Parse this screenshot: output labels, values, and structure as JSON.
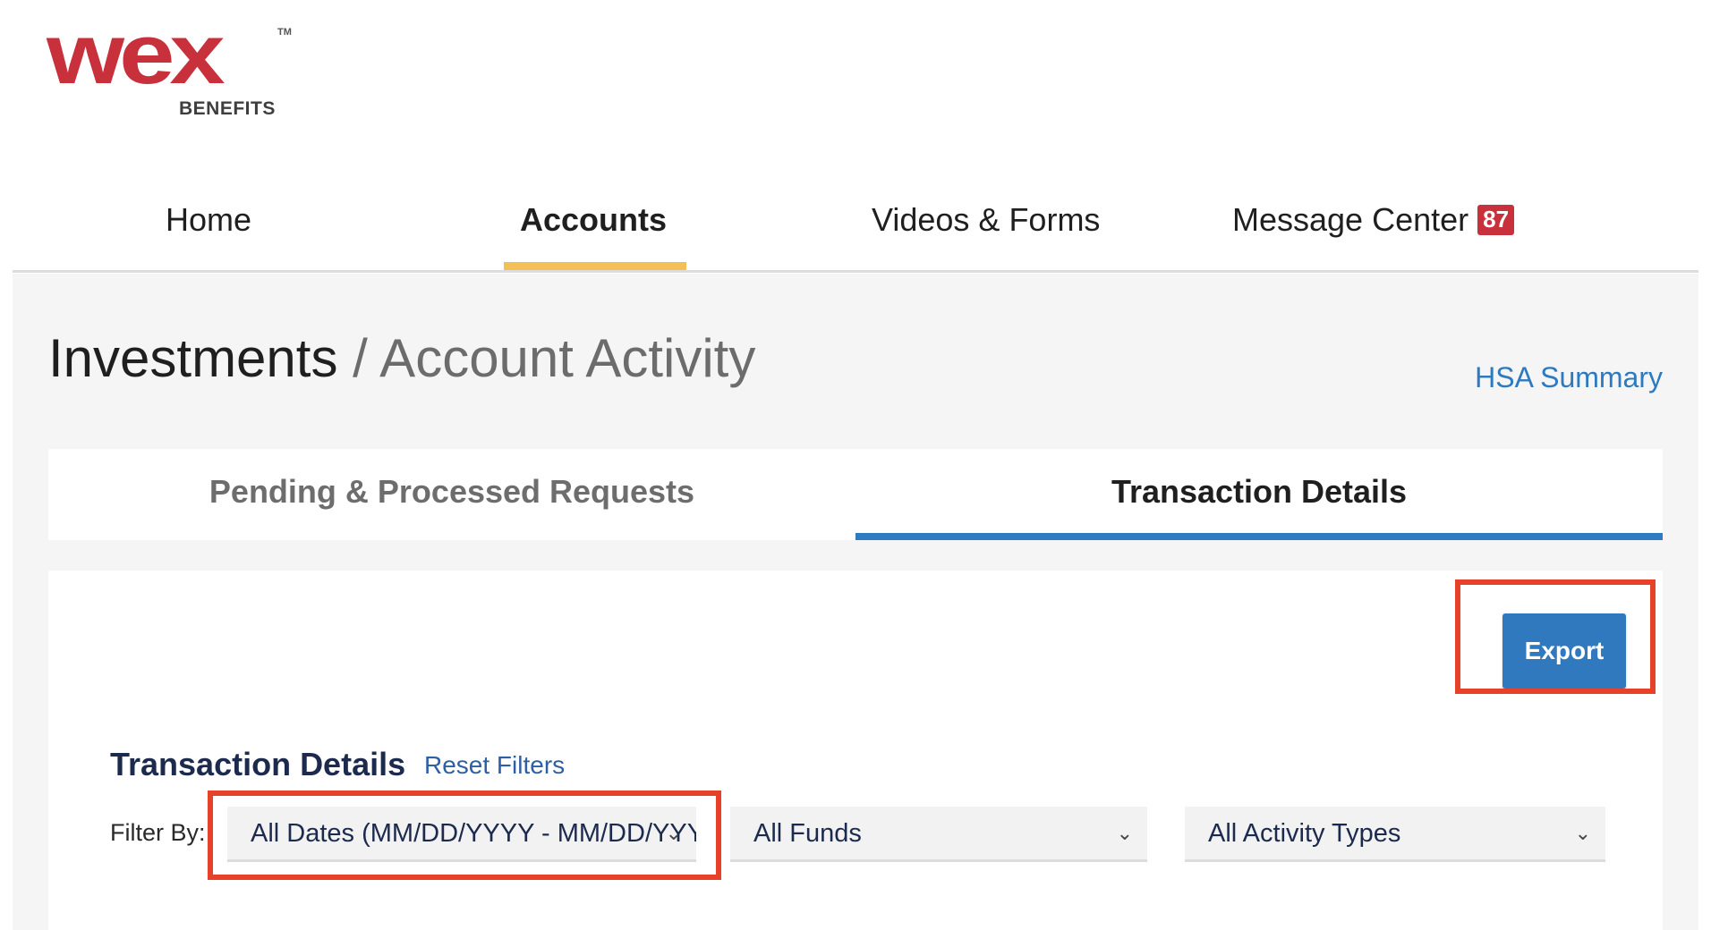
{
  "logo": {
    "word": "wex",
    "tm": "TM",
    "sub": "BENEFITS"
  },
  "nav": {
    "items": [
      {
        "label": "Home"
      },
      {
        "label": "Accounts"
      },
      {
        "label": "Videos & Forms"
      },
      {
        "label": "Message Center"
      }
    ],
    "active": "Accounts",
    "message_count": "87",
    "accent_color": "#f2c057"
  },
  "page": {
    "breadcrumb_parent": "Investments",
    "breadcrumb_separator": "/",
    "breadcrumb_current": "Account Activity",
    "hsa_summary_link": "HSA Summary"
  },
  "tabs": [
    {
      "label": "Pending & Processed Requests",
      "selected": false
    },
    {
      "label": "Transaction Details",
      "selected": true
    }
  ],
  "panel": {
    "export_label": "Export",
    "section_title": "Transaction Details",
    "reset_filters_label": "Reset Filters",
    "filter_by_label": "Filter By:",
    "filters": {
      "dates": "All Dates (MM/DD/YYYY - MM/DD/YYYY)",
      "funds": "All Funds",
      "activity_types": "All Activity Types"
    }
  },
  "colors": {
    "brand_red": "#c8303c",
    "primary_blue": "#3079bf",
    "highlight_red": "#e8412a"
  }
}
